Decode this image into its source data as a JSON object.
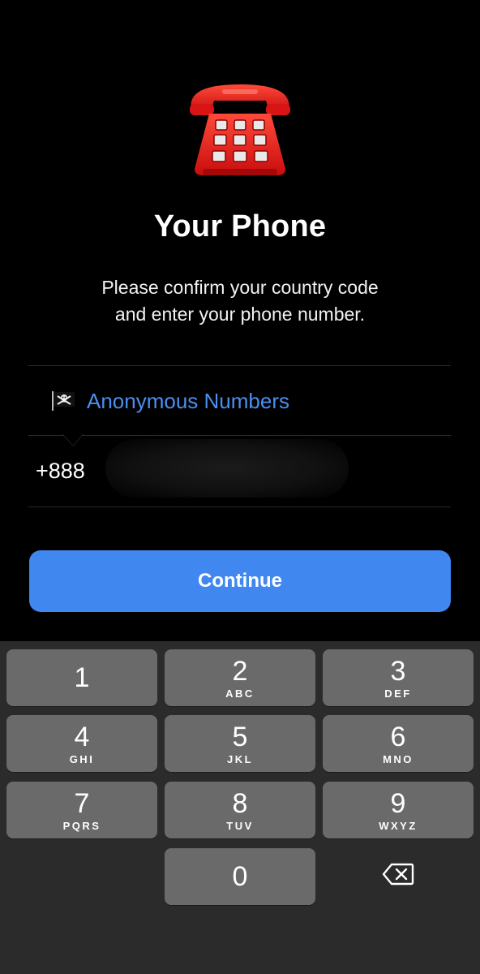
{
  "header": {
    "icon": "telephone-icon",
    "title": "Your Phone",
    "subtitle_line1": "Please confirm your country code",
    "subtitle_line2": "and enter your phone number."
  },
  "country": {
    "flag_icon": "pirate-flag-icon",
    "name": "Anonymous Numbers"
  },
  "phone": {
    "country_code": "+888",
    "number_value": ""
  },
  "continue_label": "Continue",
  "keypad": {
    "keys": [
      {
        "digit": "1",
        "letters": ""
      },
      {
        "digit": "2",
        "letters": "ABC"
      },
      {
        "digit": "3",
        "letters": "DEF"
      },
      {
        "digit": "4",
        "letters": "GHI"
      },
      {
        "digit": "5",
        "letters": "JKL"
      },
      {
        "digit": "6",
        "letters": "MNO"
      },
      {
        "digit": "7",
        "letters": "PQRS"
      },
      {
        "digit": "8",
        "letters": "TUV"
      },
      {
        "digit": "9",
        "letters": "WXYZ"
      },
      {
        "digit": "0",
        "letters": ""
      }
    ],
    "backspace_icon": "backspace-icon"
  },
  "colors": {
    "accent": "#4087f0",
    "link": "#4a8ff0",
    "background": "#000000",
    "keyboard_bg": "#2b2b2b",
    "key_bg": "#6a6a6a"
  }
}
